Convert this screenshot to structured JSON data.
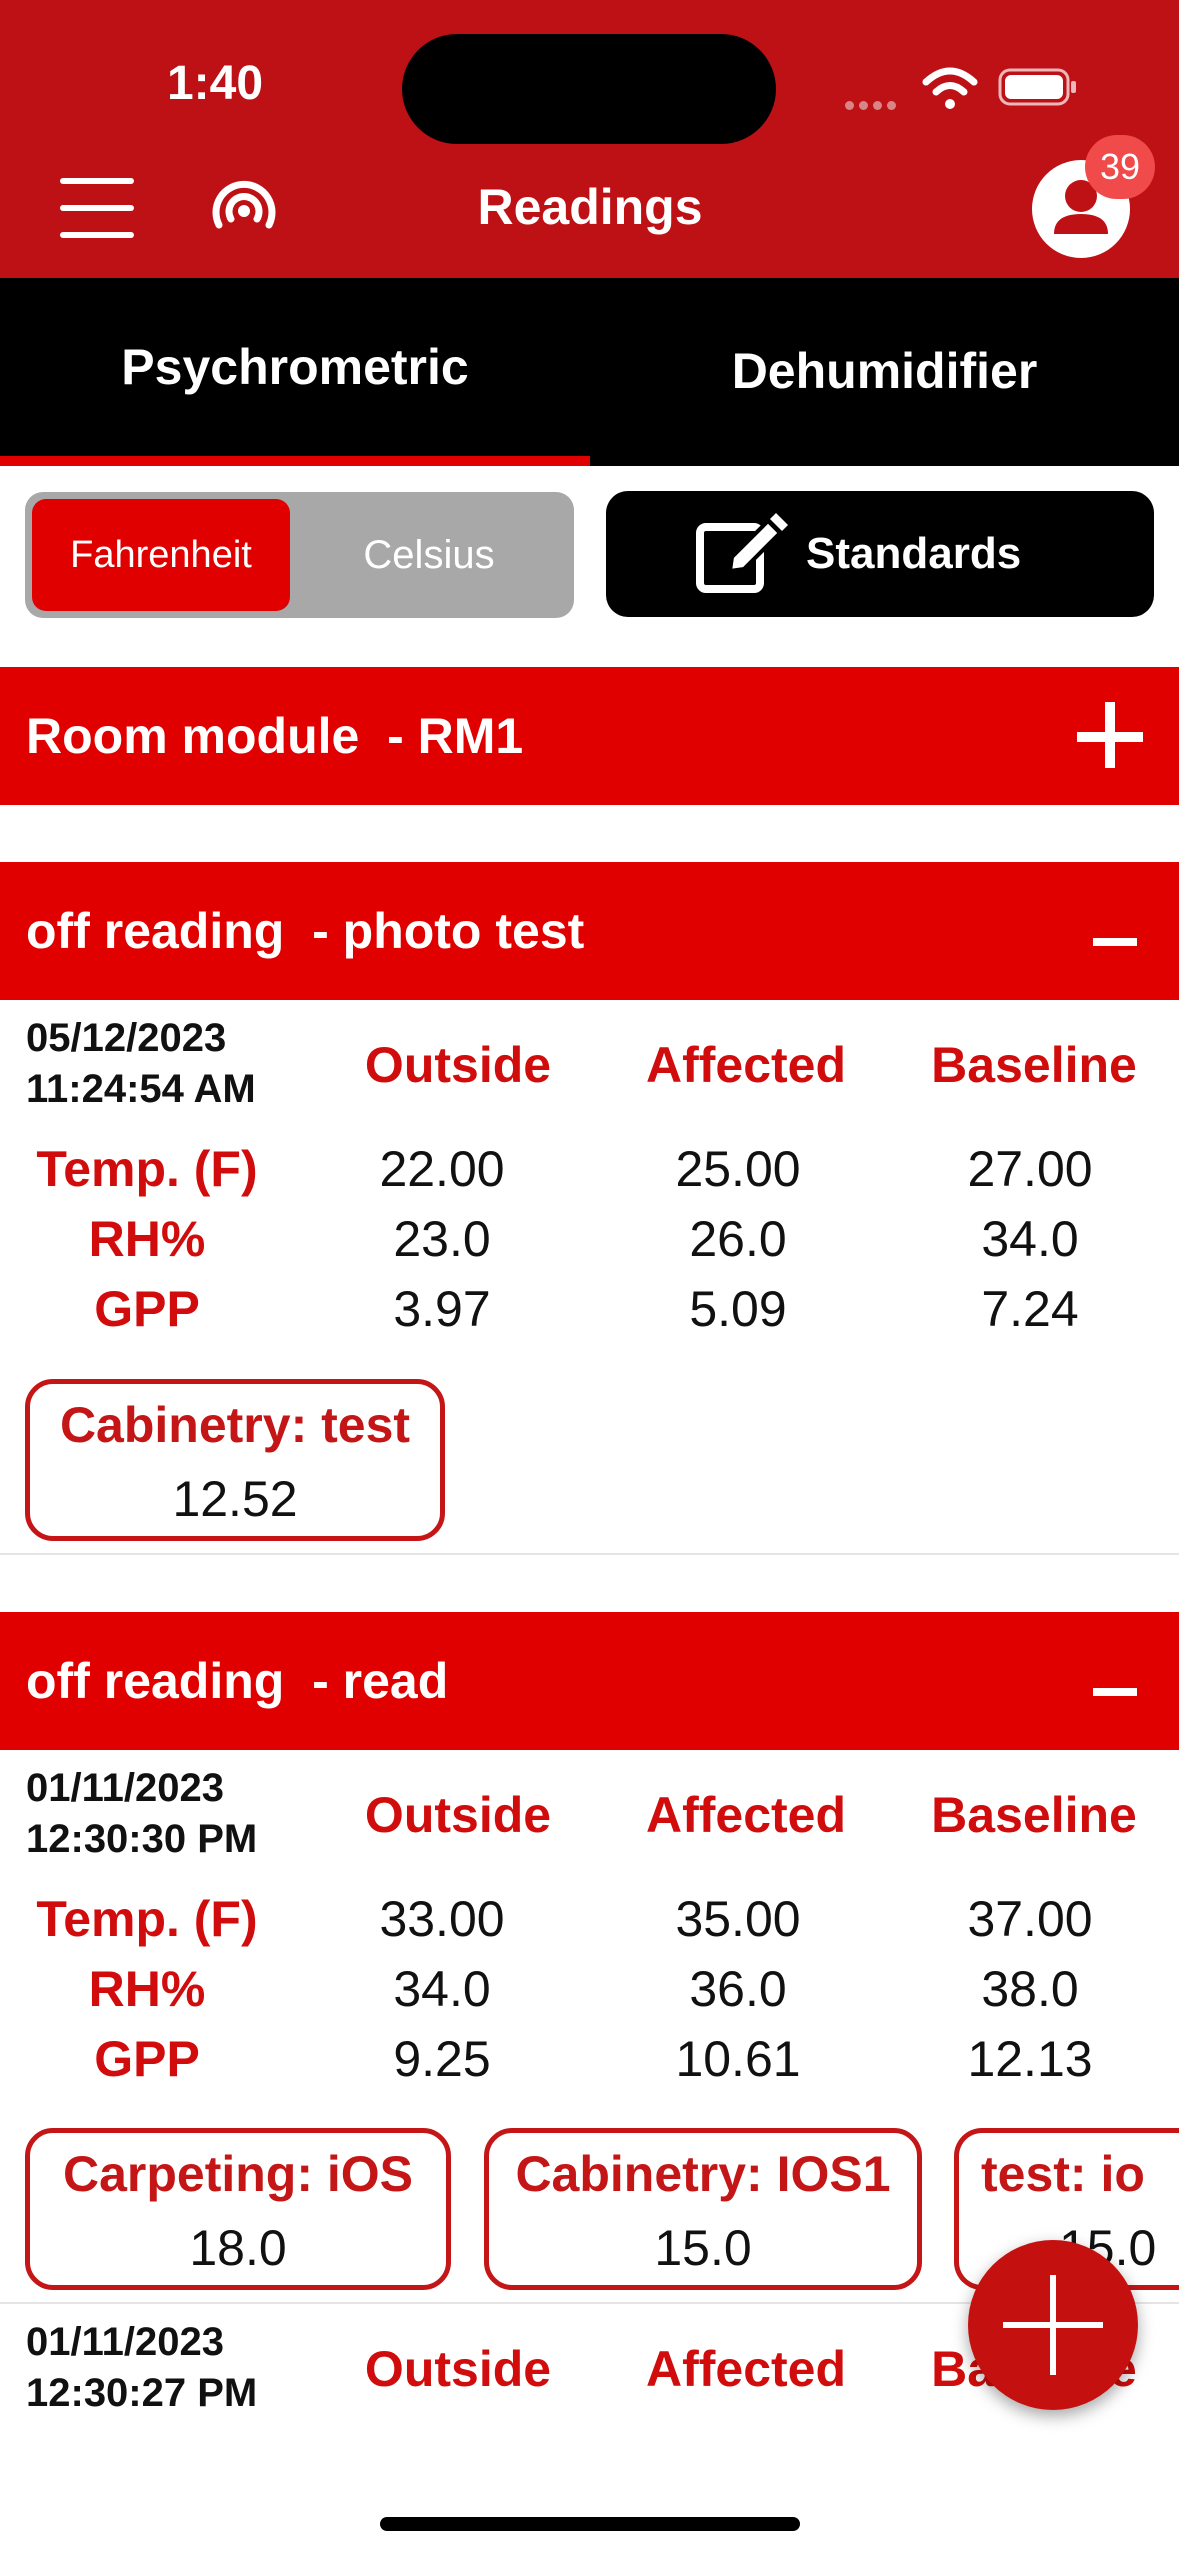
{
  "status_bar": {
    "time": "1:40"
  },
  "header": {
    "title": "Readings",
    "notification_count": "39"
  },
  "tabs": [
    {
      "label": "Psychrometric",
      "active": true
    },
    {
      "label": "Dehumidifier",
      "active": false
    }
  ],
  "unit_toggle": {
    "options": [
      "Fahrenheit",
      "Celsius"
    ],
    "selected": "Fahrenheit"
  },
  "standards_button": {
    "label": "Standards"
  },
  "room_module": {
    "title": "Room module  - RM1",
    "action_icon": "plus-icon"
  },
  "sections": [
    {
      "title": "off reading  - photo test",
      "action_icon": "minus-icon",
      "entries": [
        {
          "date": "05/12/2023",
          "time": "11:24:54 AM",
          "columns": [
            "Outside",
            "Affected",
            "Baseline"
          ],
          "rows": [
            {
              "label": "Temp. (F)",
              "values": [
                "22.00",
                "25.00",
                "27.00"
              ]
            },
            {
              "label": "RH%",
              "values": [
                "23.0",
                "26.0",
                "34.0"
              ]
            },
            {
              "label": "GPP",
              "values": [
                "3.97",
                "5.09",
                "7.24"
              ]
            }
          ],
          "materials": [
            {
              "label": "Cabinetry: test",
              "value": "12.52"
            }
          ]
        }
      ]
    },
    {
      "title": "off reading  - read",
      "action_icon": "minus-icon",
      "entries": [
        {
          "date": "01/11/2023",
          "time": "12:30:30 PM",
          "columns": [
            "Outside",
            "Affected",
            "Baseline"
          ],
          "rows": [
            {
              "label": "Temp. (F)",
              "values": [
                "33.00",
                "35.00",
                "37.00"
              ]
            },
            {
              "label": "RH%",
              "values": [
                "34.0",
                "36.0",
                "38.0"
              ]
            },
            {
              "label": "GPP",
              "values": [
                "9.25",
                "10.61",
                "12.13"
              ]
            }
          ],
          "materials": [
            {
              "label": "Carpeting: iOS",
              "value": "18.0"
            },
            {
              "label": "Cabinetry: IOS1",
              "value": "15.0"
            },
            {
              "label": "test: io",
              "value": "15.0"
            }
          ]
        },
        {
          "date": "01/11/2023",
          "time": "12:30:27 PM",
          "columns": [
            "Outside",
            "Affected",
            "Baseline"
          ]
        }
      ]
    }
  ],
  "colors": {
    "header_red": "#be1115",
    "accent_red": "#e00000",
    "label_red": "#d10c0c"
  },
  "fab": {
    "icon": "plus-icon"
  }
}
